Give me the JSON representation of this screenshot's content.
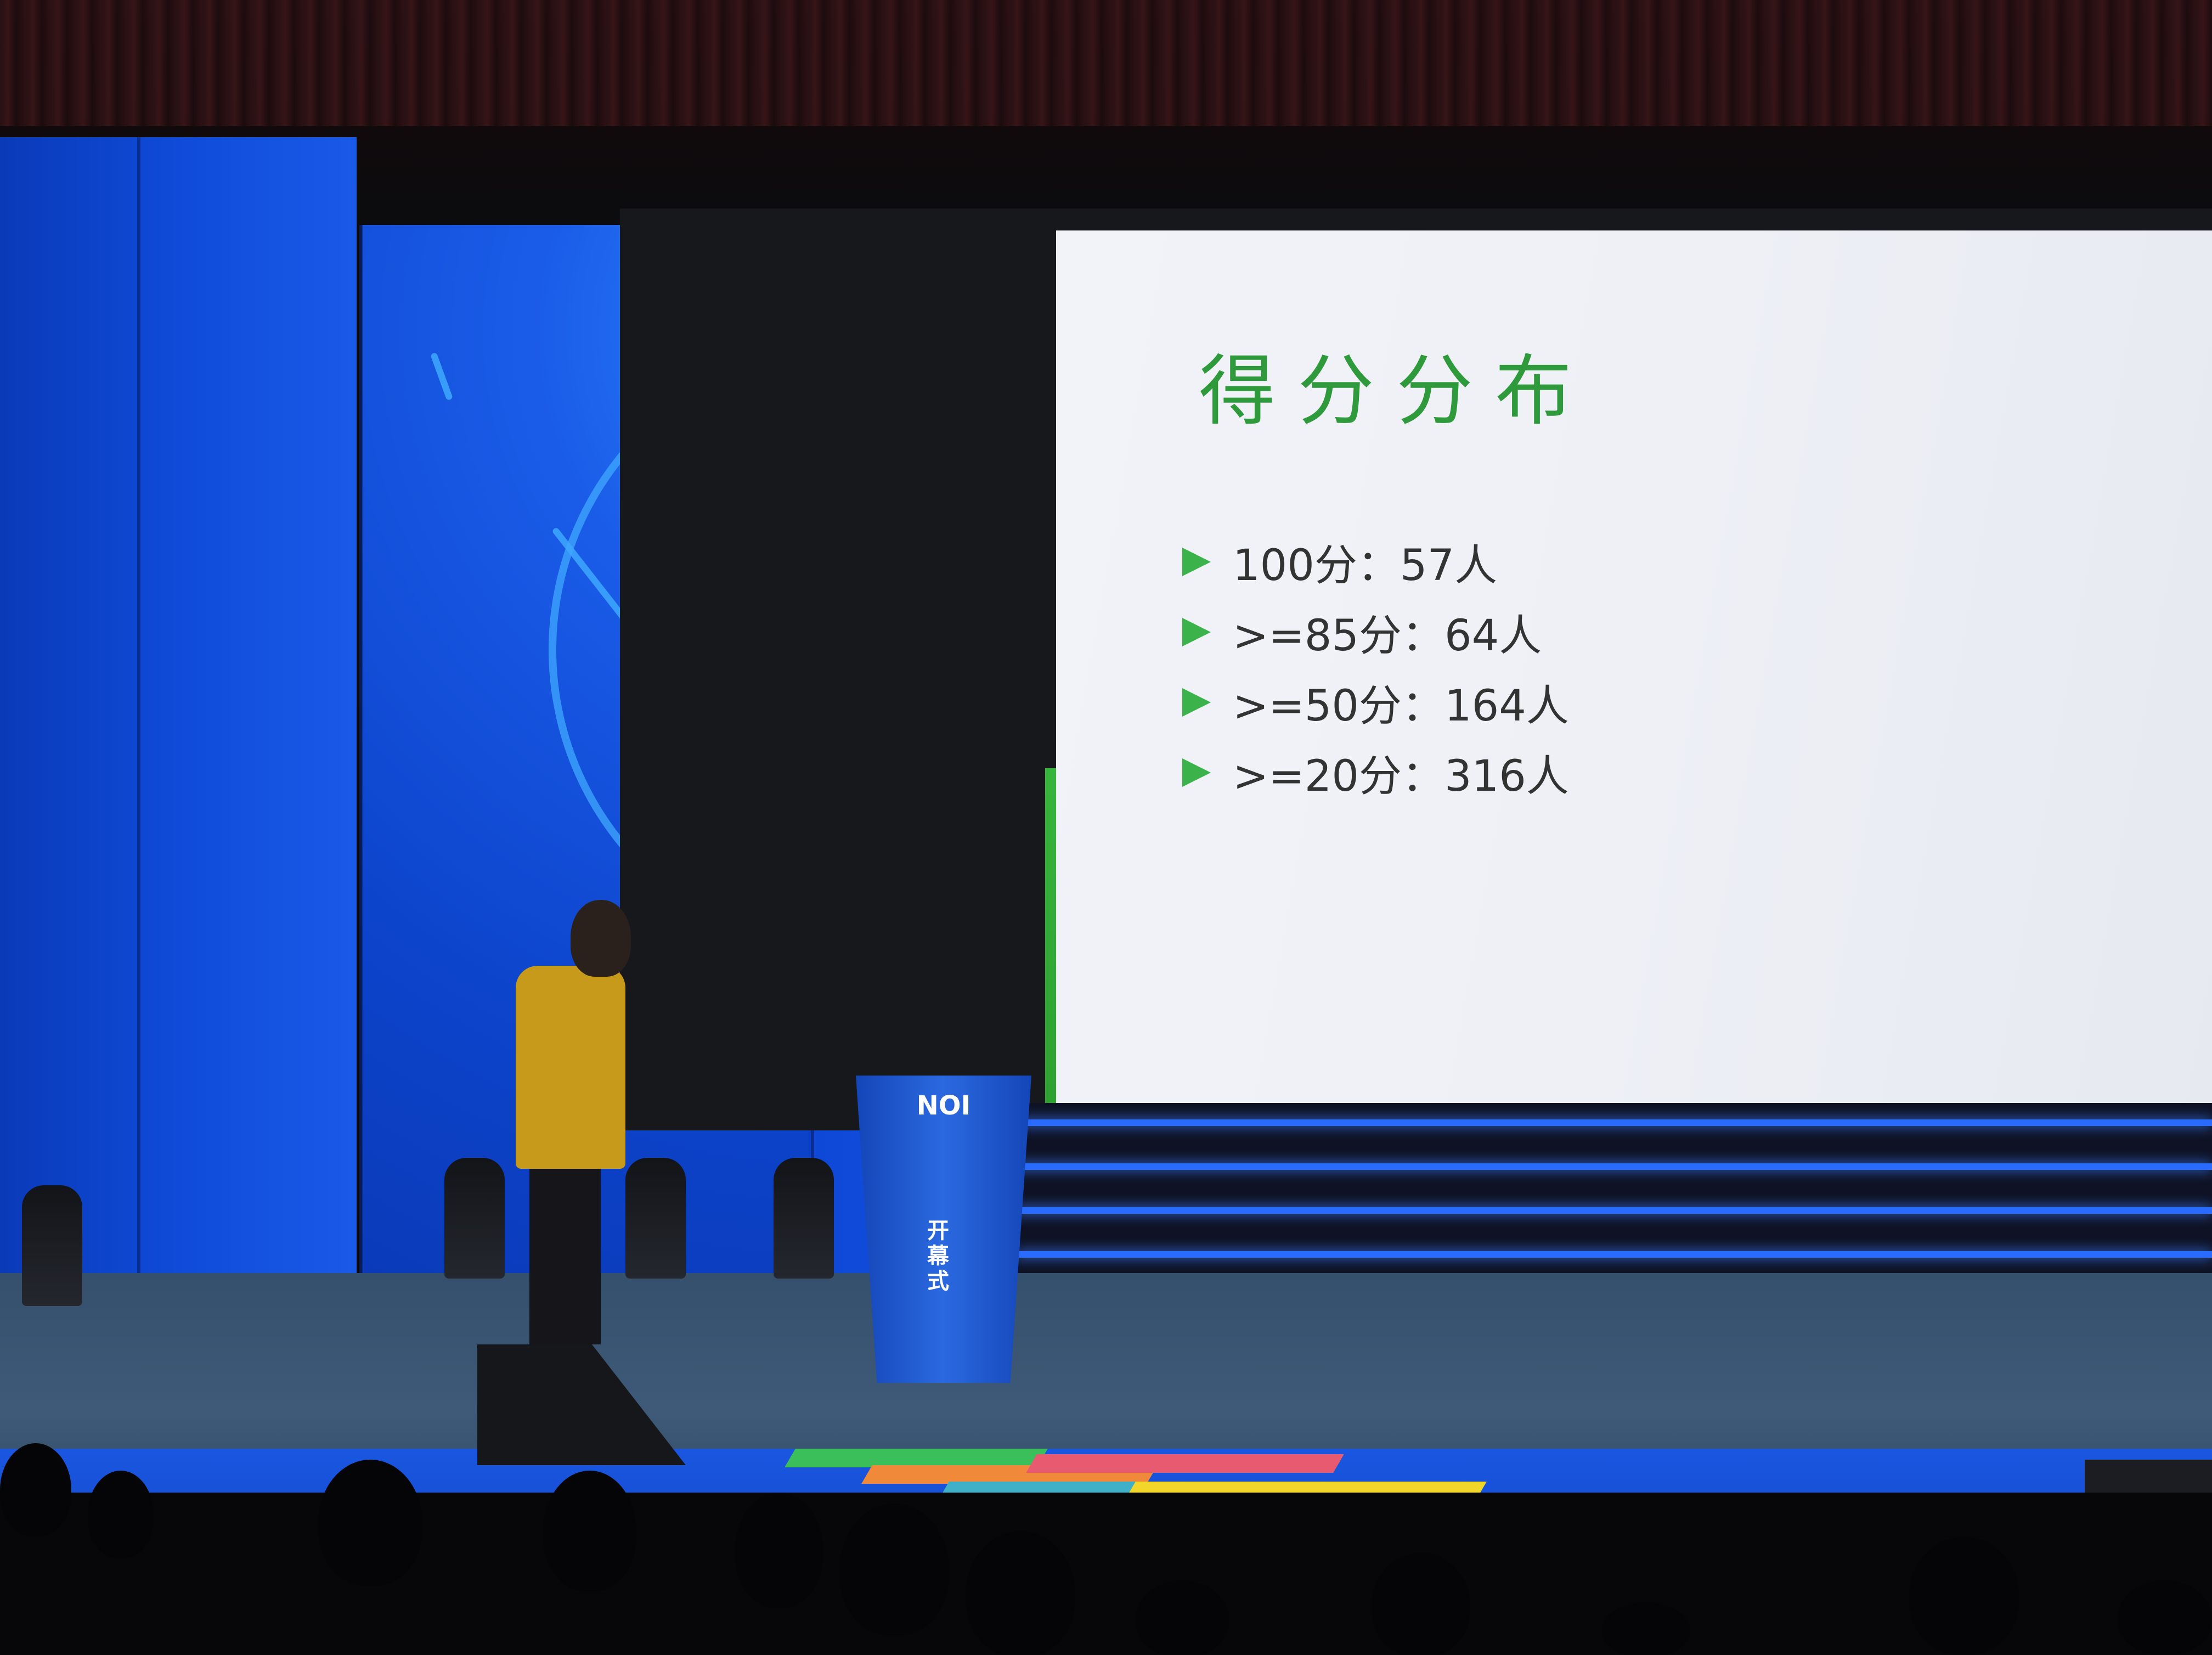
{
  "slide": {
    "title": "得分分布",
    "items": [
      {
        "label": "100分：57人"
      },
      {
        "label": ">=85分：64人"
      },
      {
        "label": ">=50分：164人"
      },
      {
        "label": ">=20分：316人"
      }
    ]
  },
  "podium": {
    "logo_text": "NOI",
    "label": "开幕式"
  },
  "colors": {
    "slide_title": "#2f9a3b",
    "bullet": "#3bb24a",
    "slide_text": "#333333",
    "stage_blue": "#1556e6",
    "speaker_shirt": "#c79a1b"
  }
}
